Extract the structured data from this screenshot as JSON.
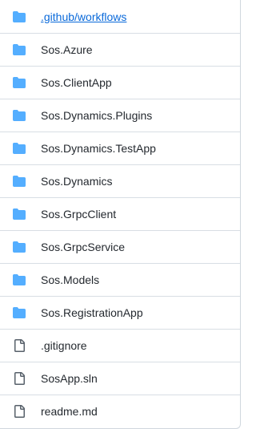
{
  "colors": {
    "folder_icon": "#54aeff",
    "file_icon": "#57606a",
    "text": "#24292f",
    "divider": "#d8dee4"
  },
  "entries": [
    {
      "name": ".github/workflows",
      "icon": "folder-icon"
    },
    {
      "name": "Sos.Azure",
      "icon": "folder-icon"
    },
    {
      "name": "Sos.ClientApp",
      "icon": "folder-icon"
    },
    {
      "name": "Sos.Dynamics.Plugins",
      "icon": "folder-icon"
    },
    {
      "name": "Sos.Dynamics.TestApp",
      "icon": "folder-icon"
    },
    {
      "name": "Sos.Dynamics",
      "icon": "folder-icon"
    },
    {
      "name": "Sos.GrpcClient",
      "icon": "folder-icon"
    },
    {
      "name": "Sos.GrpcService",
      "icon": "folder-icon"
    },
    {
      "name": "Sos.Models",
      "icon": "folder-icon"
    },
    {
      "name": "Sos.RegistrationApp",
      "icon": "folder-icon"
    },
    {
      "name": ".gitignore",
      "icon": "file-icon"
    },
    {
      "name": "SosApp.sln",
      "icon": "file-icon"
    },
    {
      "name": "readme.md",
      "icon": "file-icon"
    }
  ]
}
